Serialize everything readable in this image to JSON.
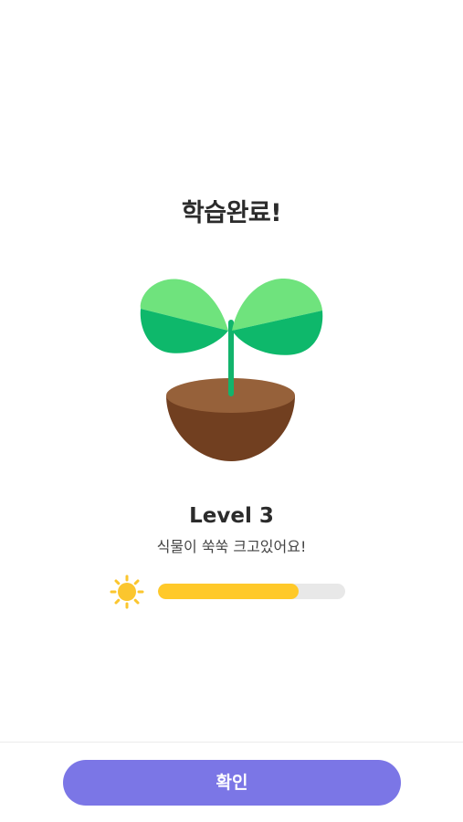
{
  "completion": {
    "title": "학습완료!",
    "level_label": "Level 3",
    "message": "식물이 쑥쑥 크고있어요!"
  },
  "progress": {
    "icon": "sun-icon",
    "value_percent": 75
  },
  "actions": {
    "confirm_label": "확인"
  },
  "colors": {
    "leaf_light": "#6FE37D",
    "leaf_dark": "#0EB86B",
    "stem": "#12B46C",
    "soil_top": "#96613A",
    "pot": "#713F20",
    "sun": "#FBC62E",
    "progress_fill": "#FFC929",
    "progress_track": "#E8E8E8",
    "button": "#7B76E6"
  }
}
